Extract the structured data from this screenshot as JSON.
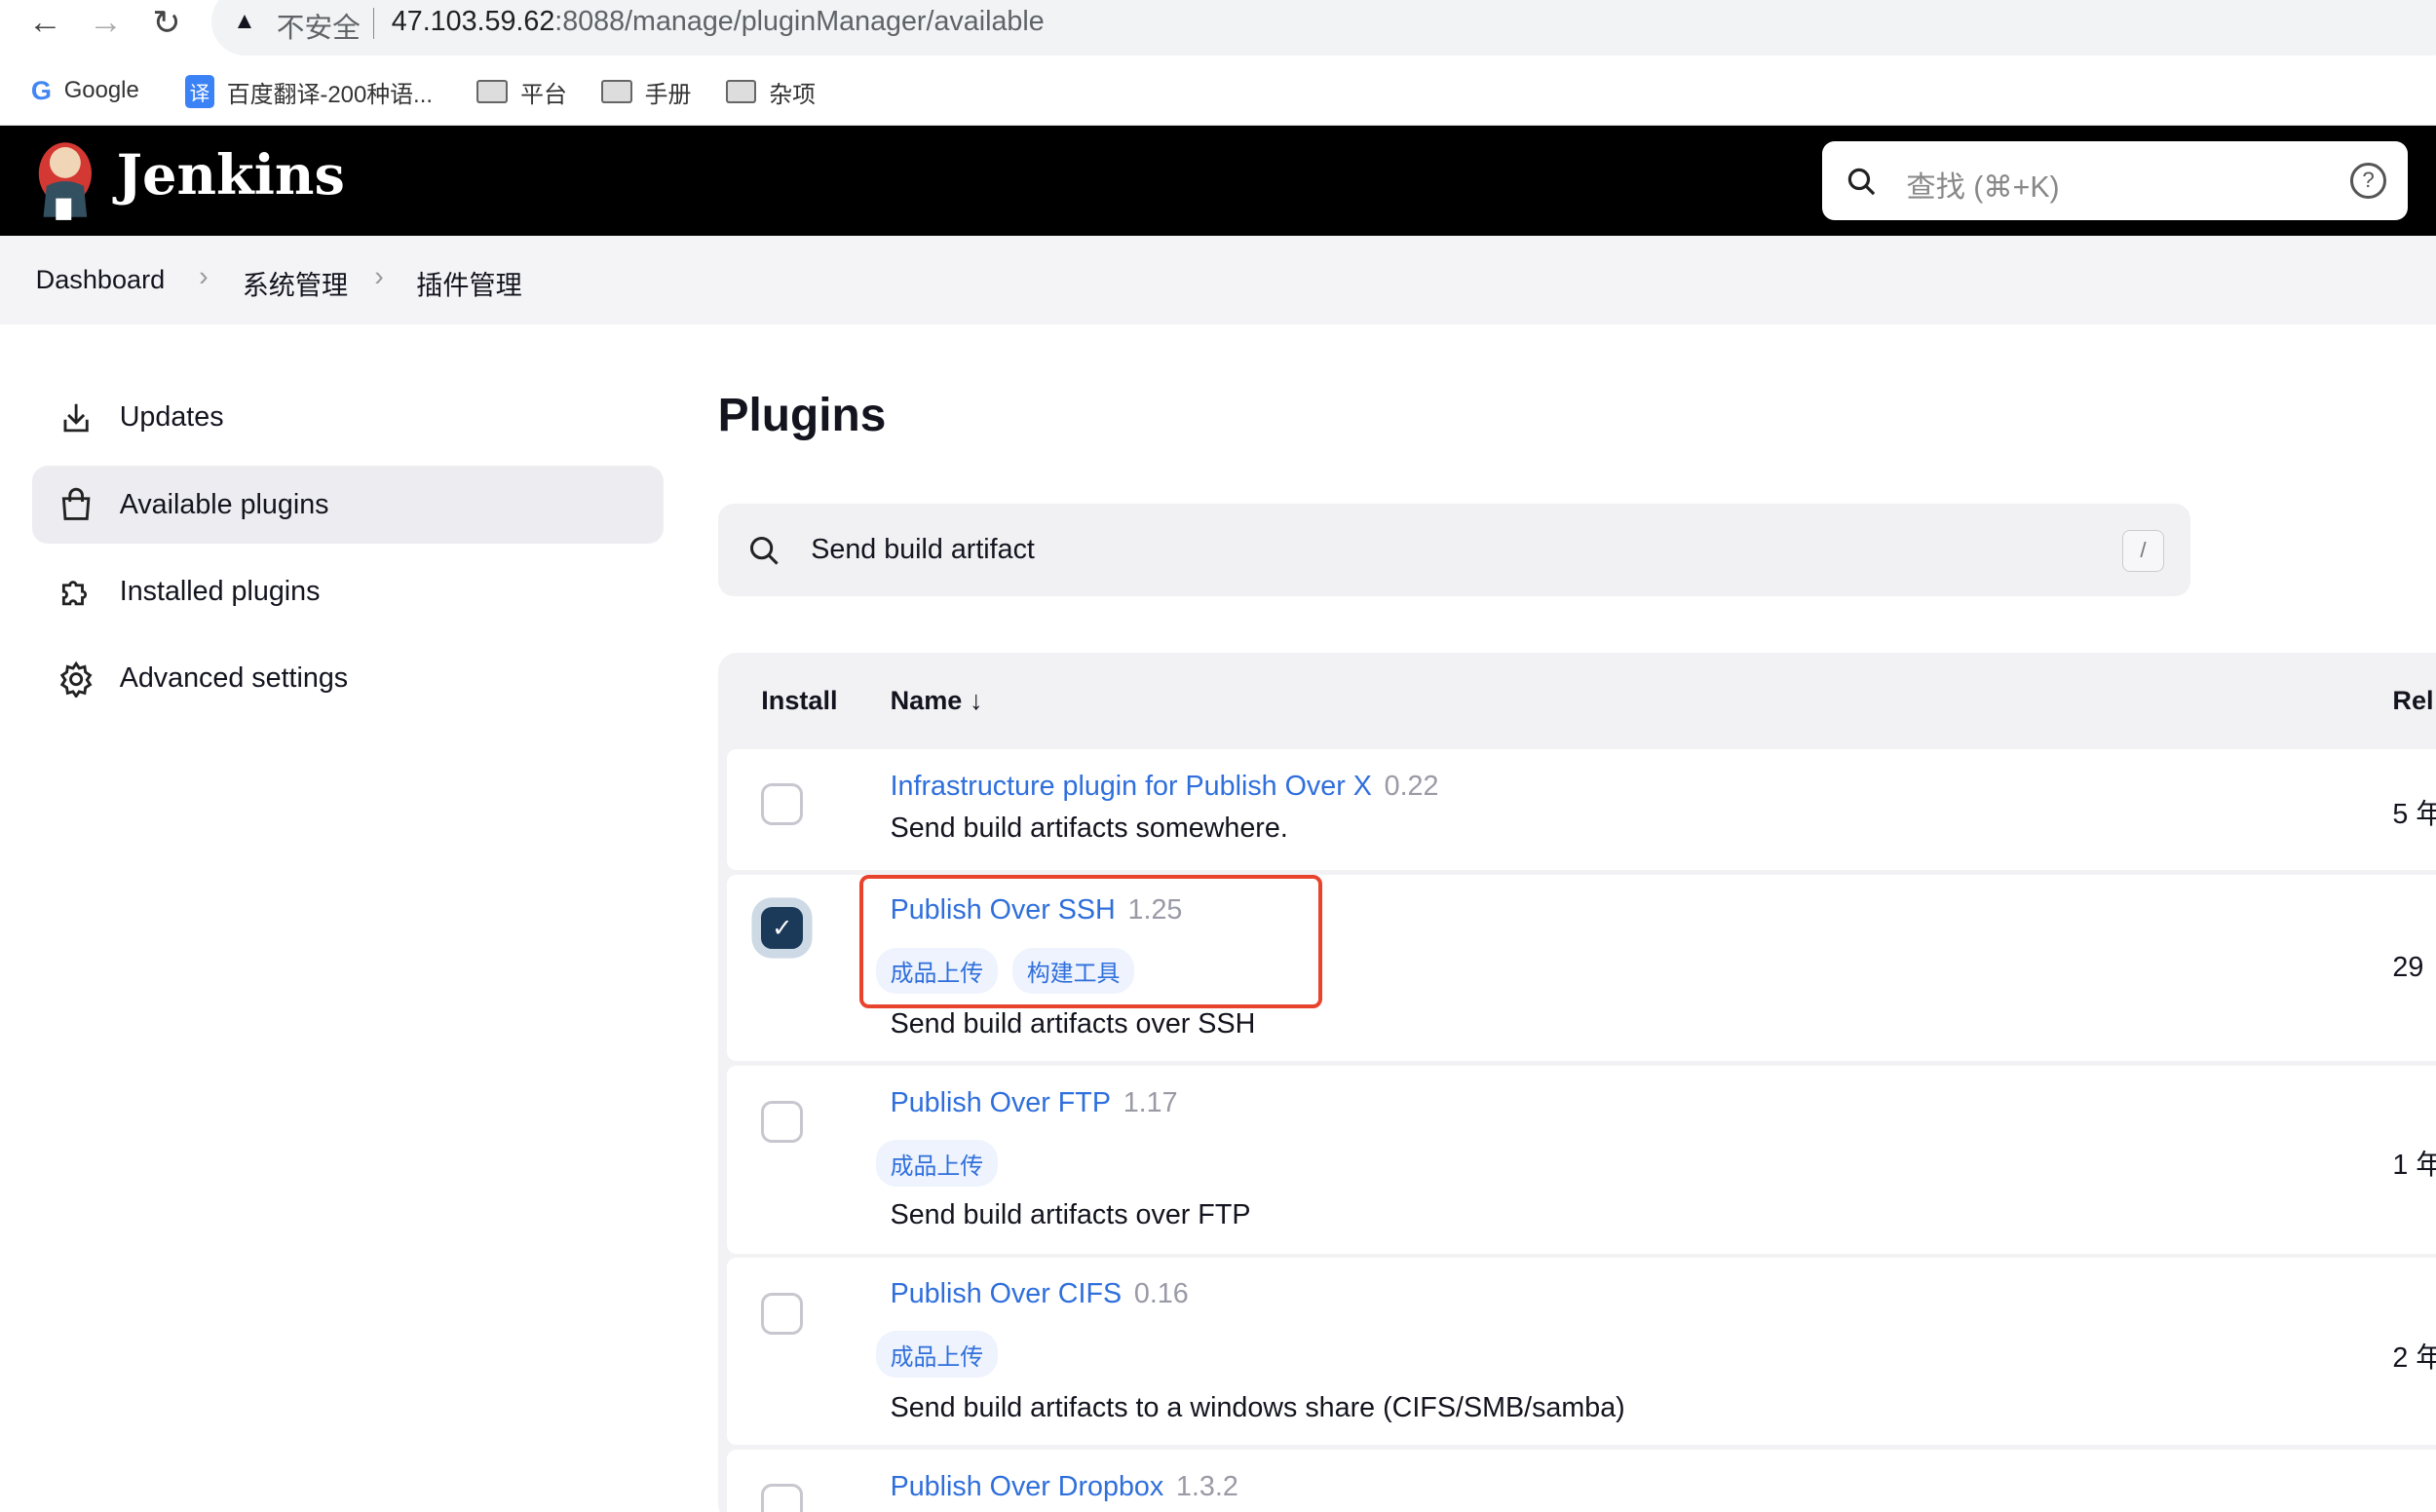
{
  "browser": {
    "security_label": "不安全",
    "url_host": "47.103.59.62",
    "url_rest": ":8088/manage/pluginManager/available",
    "bookmarks": [
      "Google",
      "百度翻译-200种语...",
      "平台",
      "手册",
      "杂项"
    ]
  },
  "header": {
    "brand": "Jenkins",
    "search_placeholder": "查找 (⌘+K)"
  },
  "breadcrumb": [
    "Dashboard",
    "系统管理",
    "插件管理"
  ],
  "sidebar": {
    "items": [
      {
        "label": "Updates",
        "icon": "download-icon"
      },
      {
        "label": "Available plugins",
        "icon": "shopping-bag-icon",
        "active": true
      },
      {
        "label": "Installed plugins",
        "icon": "puzzle-icon"
      },
      {
        "label": "Advanced settings",
        "icon": "gear-icon"
      }
    ]
  },
  "main": {
    "title": "Plugins",
    "search_value": "Send build artifact",
    "search_shortcut": "/",
    "columns": {
      "install": "Install",
      "name": "Name ↓",
      "released": "Rel"
    },
    "plugins": [
      {
        "name": "Infrastructure plugin for Publish Over X",
        "version": "0.22",
        "tags": [],
        "description": "Send build artifacts somewhere.",
        "released": "5 年",
        "checked": false
      },
      {
        "name": "Publish Over SSH",
        "version": "1.25",
        "tags": [
          "成品上传",
          "构建工具"
        ],
        "description": "Send build artifacts over SSH",
        "released": "29",
        "checked": true
      },
      {
        "name": "Publish Over FTP",
        "version": "1.17",
        "tags": [
          "成品上传"
        ],
        "description": "Send build artifacts over FTP",
        "released": "1 年",
        "checked": false
      },
      {
        "name": "Publish Over CIFS",
        "version": "0.16",
        "tags": [
          "成品上传"
        ],
        "description": "Send build artifacts to a windows share (CIFS/SMB/samba)",
        "released": "2 年",
        "checked": false
      },
      {
        "name": "Publish Over Dropbox",
        "version": "1.3.2",
        "checked": false
      }
    ]
  },
  "colors": {
    "link": "#2f6fdc",
    "highlight": "#e8432d",
    "checkbox_checked": "#1b3a5a"
  }
}
